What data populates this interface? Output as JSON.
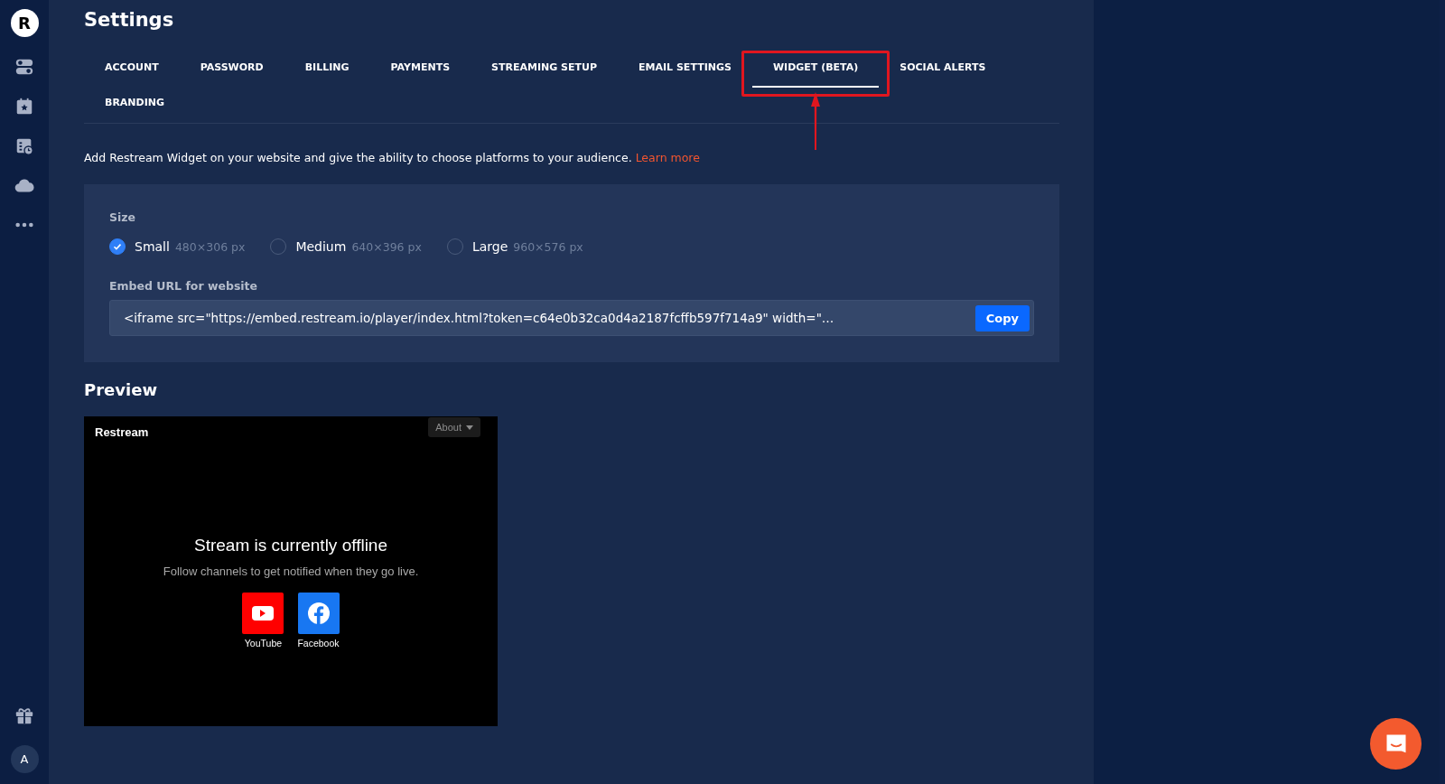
{
  "sidebar": {
    "logo": "R",
    "avatar": "A"
  },
  "page": {
    "title": "Settings"
  },
  "tabs": [
    {
      "label": "ACCOUNT",
      "selected": false,
      "highlighted": false
    },
    {
      "label": "PASSWORD",
      "selected": false,
      "highlighted": false
    },
    {
      "label": "BILLING",
      "selected": false,
      "highlighted": false
    },
    {
      "label": "PAYMENTS",
      "selected": false,
      "highlighted": false
    },
    {
      "label": "STREAMING SETUP",
      "selected": false,
      "highlighted": false
    },
    {
      "label": "EMAIL SETTINGS",
      "selected": false,
      "highlighted": false
    },
    {
      "label": "WIDGET (BETA)",
      "selected": true,
      "highlighted": true
    },
    {
      "label": "SOCIAL ALERTS",
      "selected": false,
      "highlighted": false
    },
    {
      "label": "BRANDING",
      "selected": false,
      "highlighted": false
    }
  ],
  "description": {
    "text": "Add Restream Widget on your website and give the ability to choose platforms to your audience.",
    "link": "Learn more"
  },
  "size": {
    "label": "Size",
    "options": [
      {
        "label": "Small",
        "dims": "480×306 px",
        "selected": true
      },
      {
        "label": "Medium",
        "dims": "640×396 px",
        "selected": false
      },
      {
        "label": "Large",
        "dims": "960×576 px",
        "selected": false
      }
    ]
  },
  "embed": {
    "label": "Embed URL for website",
    "value": "<iframe src=\"https://embed.restream.io/player/index.html?token=c64e0b32ca0d4a2187fcffb597f714a9\" width=\"…",
    "button": "Copy"
  },
  "preview": {
    "title": "Preview",
    "brand": "Restream",
    "about": "About",
    "heading": "Stream is currently offline",
    "subtitle": "Follow channels to get notified when they go live.",
    "channels": [
      {
        "name": "YouTube",
        "kind": "youtube"
      },
      {
        "name": "Facebook",
        "kind": "facebook"
      }
    ]
  }
}
